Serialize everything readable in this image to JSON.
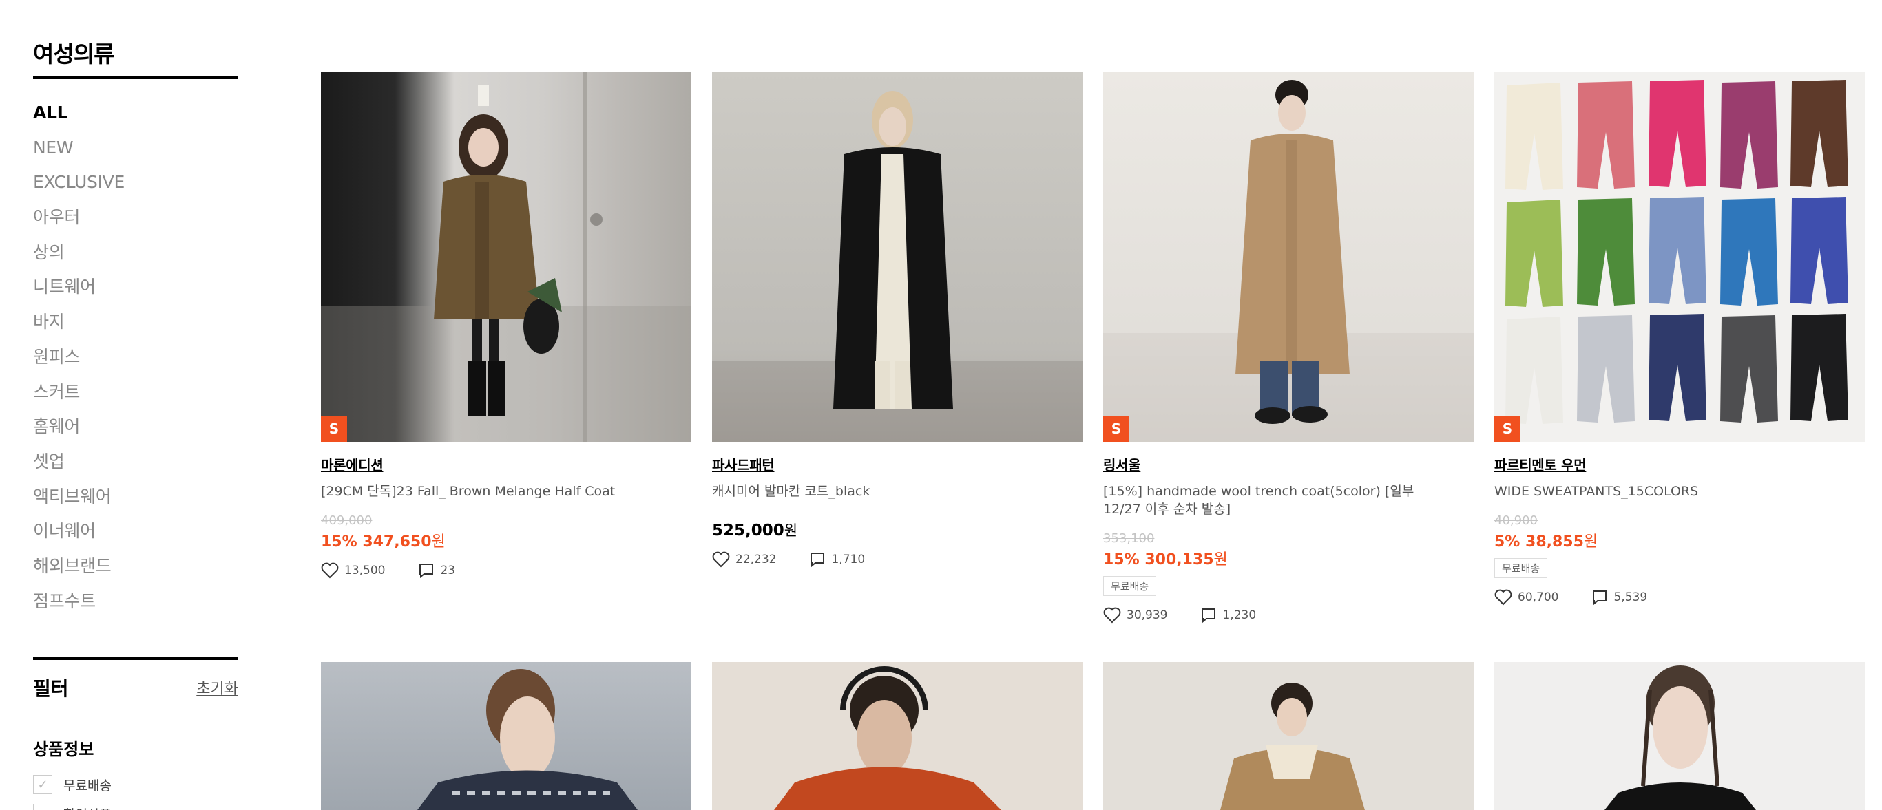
{
  "category": {
    "title": "여성의류",
    "items": [
      "ALL",
      "NEW",
      "EXCLUSIVE",
      "아우터",
      "상의",
      "니트웨어",
      "바지",
      "원피스",
      "스커트",
      "홈웨어",
      "셋업",
      "액티브웨어",
      "이너웨어",
      "해외브랜드",
      "점프수트"
    ]
  },
  "filter": {
    "title": "필터",
    "reset": "초기화",
    "section": "상품정보",
    "options": [
      "무료배송",
      "할인상품"
    ]
  },
  "badge_label": "S",
  "won": "원",
  "colors": {
    "accent": "#f1501f"
  },
  "products": [
    {
      "brand": "마론에디션",
      "name": "[29CM 단독]23 Fall_ Brown Melange Half Coat",
      "original_price": "409,000",
      "sale": "15% 347,650",
      "likes": "13,500",
      "reviews": "23"
    },
    {
      "brand": "파사드패턴",
      "name": "캐시미어 발마칸 코트_black",
      "price": "525,000",
      "likes": "22,232",
      "reviews": "1,710"
    },
    {
      "brand": "링서울",
      "name": "[15%] handmade wool trench coat(5color) [일부 12/27 이후 순차 발송]",
      "original_price": "353,100",
      "sale": "15% 300,135",
      "shipping": "무료배송",
      "likes": "30,939",
      "reviews": "1,230"
    },
    {
      "brand": "파르티멘토 우먼",
      "name": "WIDE SWEATPANTS_15COLORS",
      "original_price": "40,900",
      "sale": "5% 38,855",
      "shipping": "무료배송",
      "likes": "60,700",
      "reviews": "5,539"
    }
  ]
}
